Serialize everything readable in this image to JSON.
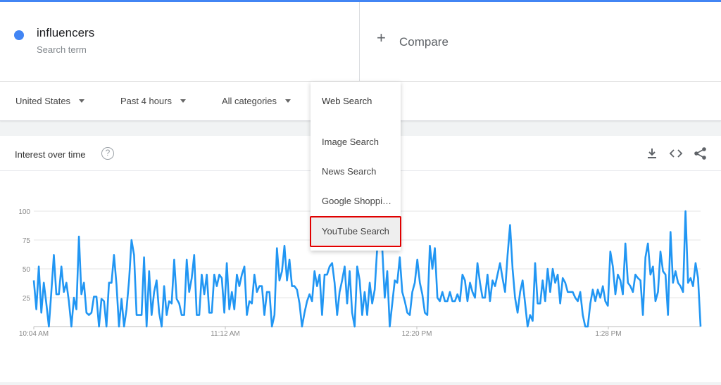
{
  "search_term": {
    "name": "influencers",
    "subtitle": "Search term",
    "color": "#4285f4"
  },
  "compare": {
    "icon": "plus-icon",
    "label": "Compare"
  },
  "filters": {
    "region": "United States",
    "time": "Past 4 hours",
    "category": "All categories",
    "property": "Web Search"
  },
  "property_dropdown": {
    "selected": "Web Search",
    "options": [
      "Image Search",
      "News Search",
      "Google Shoppi…",
      "YouTube Search"
    ],
    "hovered_index": 3
  },
  "card": {
    "title": "Interest over time",
    "help_icon": "help-circle-icon",
    "tools": [
      "download-icon",
      "embed-code-icon",
      "share-icon"
    ]
  },
  "chart_data": {
    "type": "line",
    "x_ticks": [
      "10:04 AM",
      "11:12 AM",
      "12:20 PM",
      "1:28 PM"
    ],
    "y_ticks": [
      25,
      50,
      75,
      100
    ],
    "ylim": [
      0,
      100
    ],
    "grid": true,
    "series": [
      {
        "color": "#2196f3",
        "values": [
          40,
          15,
          52,
          12,
          38,
          20,
          0,
          30,
          62,
          28,
          28,
          52,
          30,
          38,
          22,
          0,
          25,
          15,
          78,
          28,
          38,
          12,
          10,
          12,
          26,
          26,
          0,
          24,
          22,
          0,
          38,
          38,
          62,
          36,
          0,
          24,
          0,
          15,
          40,
          75,
          62,
          10,
          10,
          10,
          60,
          0,
          48,
          10,
          30,
          40,
          12,
          0,
          35,
          10,
          22,
          20,
          58,
          24,
          20,
          10,
          10,
          58,
          30,
          42,
          62,
          10,
          10,
          45,
          28,
          45,
          12,
          12,
          45,
          35,
          45,
          42,
          12,
          55,
          15,
          30,
          15,
          45,
          35,
          45,
          52,
          10,
          22,
          20,
          45,
          30,
          35,
          35,
          10,
          30,
          30,
          0,
          10,
          68,
          40,
          48,
          70,
          40,
          58,
          35,
          35,
          32,
          20,
          0,
          12,
          22,
          28,
          22,
          48,
          35,
          45,
          10,
          45,
          45,
          52,
          55,
          38,
          10,
          30,
          40,
          52,
          20,
          48,
          12,
          0,
          52,
          40,
          10,
          30,
          10,
          38,
          20,
          32,
          68,
          78,
          68,
          25,
          48,
          0,
          20,
          40,
          38,
          60,
          30,
          22,
          12,
          10,
          30,
          38,
          58,
          38,
          28,
          12,
          10,
          70,
          50,
          68,
          25,
          22,
          30,
          22,
          22,
          30,
          22,
          22,
          28,
          22,
          45,
          40,
          22,
          38,
          30,
          25,
          55,
          38,
          25,
          25,
          45,
          22,
          40,
          35,
          45,
          55,
          42,
          30,
          62,
          88,
          50,
          25,
          12,
          30,
          40,
          20,
          0,
          10,
          5,
          55,
          20,
          20,
          40,
          22,
          50,
          30,
          50,
          38,
          45,
          20,
          42,
          38,
          30,
          30,
          30,
          25,
          22,
          30,
          10,
          0,
          0,
          20,
          32,
          22,
          32,
          25,
          35,
          22,
          18,
          65,
          52,
          28,
          45,
          40,
          28,
          72,
          38,
          35,
          30,
          45,
          42,
          40,
          10,
          60,
          72,
          45,
          52,
          22,
          30,
          65,
          48,
          45,
          10,
          82,
          38,
          48,
          38,
          35,
          30,
          100,
          38,
          42,
          35,
          55,
          42,
          0
        ]
      }
    ]
  }
}
